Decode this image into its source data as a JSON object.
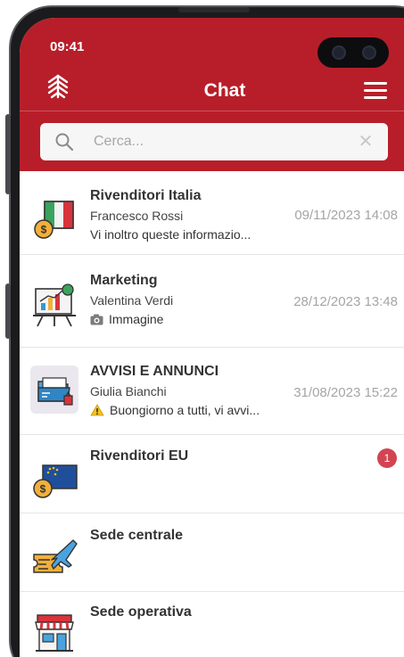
{
  "status_bar": {
    "time": "09:41"
  },
  "header": {
    "title": "Chat"
  },
  "search": {
    "placeholder": "Cerca..."
  },
  "chats": [
    {
      "name": "Rivenditori Italia",
      "sender": "Francesco Rossi",
      "preview": "Vi inoltro queste informazio...",
      "date": "09/11/2023 14:08",
      "icon": "italy-flag-coin-icon"
    },
    {
      "name": "Marketing",
      "sender": "Valentina Verdi",
      "preview": "Immagine",
      "preview_icon": "camera-icon",
      "date": "28/12/2023 13:48",
      "icon": "presentation-chart-icon"
    },
    {
      "name": "AVVISI E ANNUNCI",
      "sender": "Giulia Bianchi",
      "preview": "Buongiorno a tutti, vi avvi...",
      "preview_icon": "warning-icon",
      "date": "31/08/2023 15:22",
      "icon": "folder-alert-icon"
    },
    {
      "name": "Rivenditori EU",
      "unread": "1",
      "icon": "eu-flag-coin-icon"
    },
    {
      "name": "Sede centrale",
      "icon": "ticket-plane-icon"
    },
    {
      "name": "Sede operativa",
      "icon": "storefront-icon"
    }
  ],
  "colors": {
    "brand": "#b81e29",
    "badge": "#d24452",
    "date": "#a5a5a5"
  }
}
